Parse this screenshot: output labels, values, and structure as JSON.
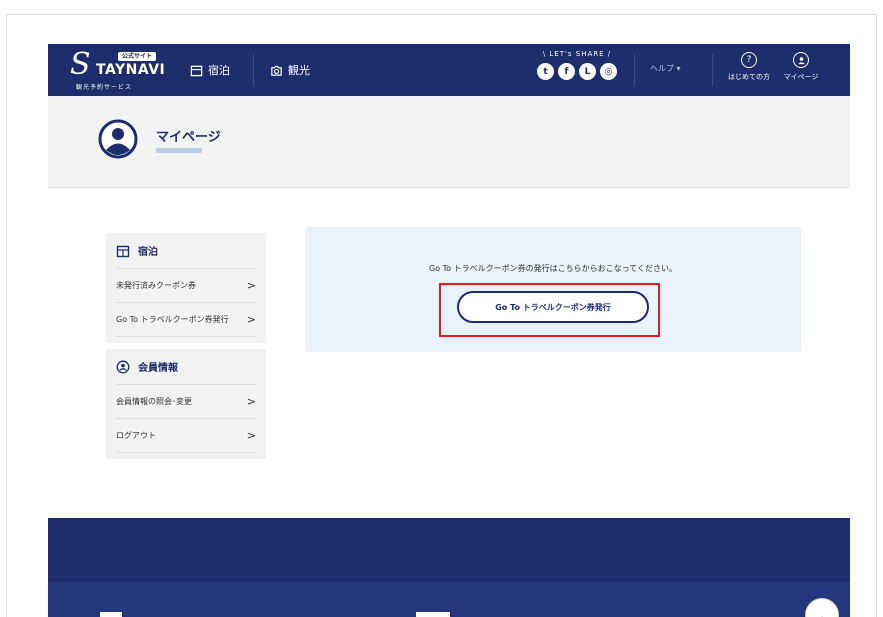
{
  "header": {
    "logo": {
      "badge": "公式サイト",
      "main": "TAYNAVI",
      "initial": "S",
      "sub": "観光予約サービス"
    },
    "nav": [
      {
        "label": "宿泊",
        "icon": "hotel-icon"
      },
      {
        "label": "観光",
        "icon": "camera-icon"
      }
    ],
    "share": {
      "label": "\\ LET's SHARE /",
      "icons": [
        {
          "name": "twitter-icon",
          "glyph": "t"
        },
        {
          "name": "facebook-icon",
          "glyph": "f"
        },
        {
          "name": "line-icon",
          "glyph": "L"
        },
        {
          "name": "instagram-icon",
          "glyph": "◎"
        }
      ]
    },
    "help_label": "ヘルプ ▾",
    "guide_label": "はじめての方",
    "mypage_label": "マイページ"
  },
  "profile": {
    "title": "マイページ"
  },
  "sidebar": {
    "sections": [
      {
        "heading": "宿泊",
        "icon": "hotel-icon",
        "items": [
          {
            "label": "未発行済みクーポン券"
          },
          {
            "label": "Go To トラベルクーポン券発行"
          }
        ]
      },
      {
        "heading": "会員情報",
        "icon": "member-icon",
        "items": [
          {
            "label": "会員情報の照会･変更"
          },
          {
            "label": "ログアウト"
          }
        ]
      }
    ]
  },
  "main": {
    "message": "Go To トラベルクーポン券の発行はこちらからおこなってください。",
    "button_label": "Go To トラベルクーポン券発行"
  },
  "colors": {
    "brand": "#1e2d6b",
    "highlight": "#e31b23",
    "card": "#e8f2fb"
  }
}
